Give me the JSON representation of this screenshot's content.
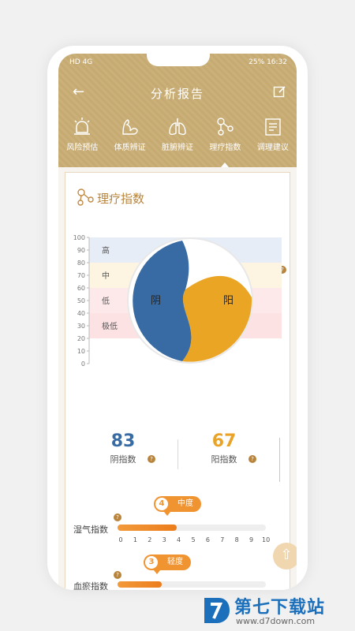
{
  "status_bar": {
    "left": "HD 4G",
    "battery": "25%",
    "time": "16:32"
  },
  "header": {
    "title": "分析报告"
  },
  "tabs": [
    {
      "label": "风险预估",
      "icon": "alarm-icon",
      "active": false
    },
    {
      "label": "体质辨证",
      "icon": "muscle-icon",
      "active": false
    },
    {
      "label": "脏腑辨证",
      "icon": "lungs-icon",
      "active": false
    },
    {
      "label": "理疗指数",
      "icon": "molecule-icon",
      "active": true
    },
    {
      "label": "调理建议",
      "icon": "clipboard-icon",
      "active": false
    }
  ],
  "section": {
    "title": "理疗指数",
    "help": "?"
  },
  "chart_data": {
    "type": "pie",
    "y_ticks": [
      "100",
      "90",
      "80",
      "70",
      "60",
      "50",
      "40",
      "30",
      "20",
      "10",
      "0"
    ],
    "bands": [
      {
        "label": "高",
        "from": 80,
        "to": 100,
        "color": "#e7edf6"
      },
      {
        "label": "中",
        "from": 60,
        "to": 80,
        "color": "#fdf5e1"
      },
      {
        "label": "低",
        "from": 40,
        "to": 60,
        "color": "#fde9ea"
      },
      {
        "label": "极低",
        "from": 20,
        "to": 40,
        "color": "#fde2e4"
      }
    ],
    "yin_label": "阴",
    "yang_label": "阳",
    "colors": {
      "yin": "#386ba3",
      "yang": "#eba524"
    }
  },
  "scores": {
    "yin": {
      "value": "83",
      "label": "阴指数",
      "color": "#386ba3"
    },
    "yang": {
      "value": "67",
      "label": "阳指数",
      "color": "#e9a326"
    }
  },
  "indices": [
    {
      "label": "湿气指数",
      "value": 4,
      "level_num": "4",
      "level_text": "中度"
    },
    {
      "label": "血瘀指数",
      "value": 3,
      "level_num": "3",
      "level_text": "轻度"
    }
  ],
  "scale": [
    "0",
    "1",
    "2",
    "3",
    "4",
    "5",
    "6",
    "7",
    "8",
    "9",
    "10"
  ],
  "bottom_hint": "…",
  "watermark": {
    "name": "第七下载站",
    "url": "www.d7down.com"
  }
}
